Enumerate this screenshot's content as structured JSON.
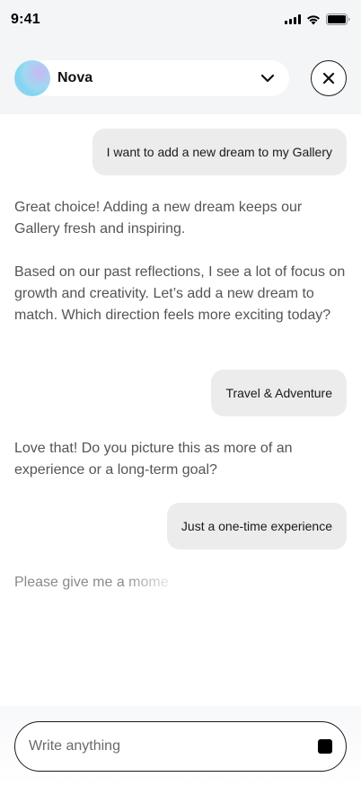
{
  "status_bar": {
    "time": "9:41"
  },
  "header": {
    "assistant_name": "Nova"
  },
  "messages": [
    {
      "role": "user",
      "text": "I want to add a new dream to my Gallery"
    },
    {
      "role": "assistant",
      "text": "Great choice! Adding a new dream keeps our Gallery fresh and inspiring.\n\nBased on our past reflections, I see a lot of focus on growth and creativity. Let’s add a new dream to match. Which direction feels more exciting today?"
    },
    {
      "role": "user",
      "text": "Travel & Adventure"
    },
    {
      "role": "assistant",
      "text": "Love that! Do you picture this as more of an experience or a long-term goal?"
    },
    {
      "role": "user",
      "text": "Just a one-time experience"
    },
    {
      "role": "assistant",
      "text": "Please give me a mome"
    }
  ],
  "composer": {
    "placeholder": "Write anything"
  },
  "colors": {
    "top_background": "#f4f5f7",
    "user_bubble": "#ececec",
    "assistant_text": "#555555",
    "accent": "#000000"
  }
}
